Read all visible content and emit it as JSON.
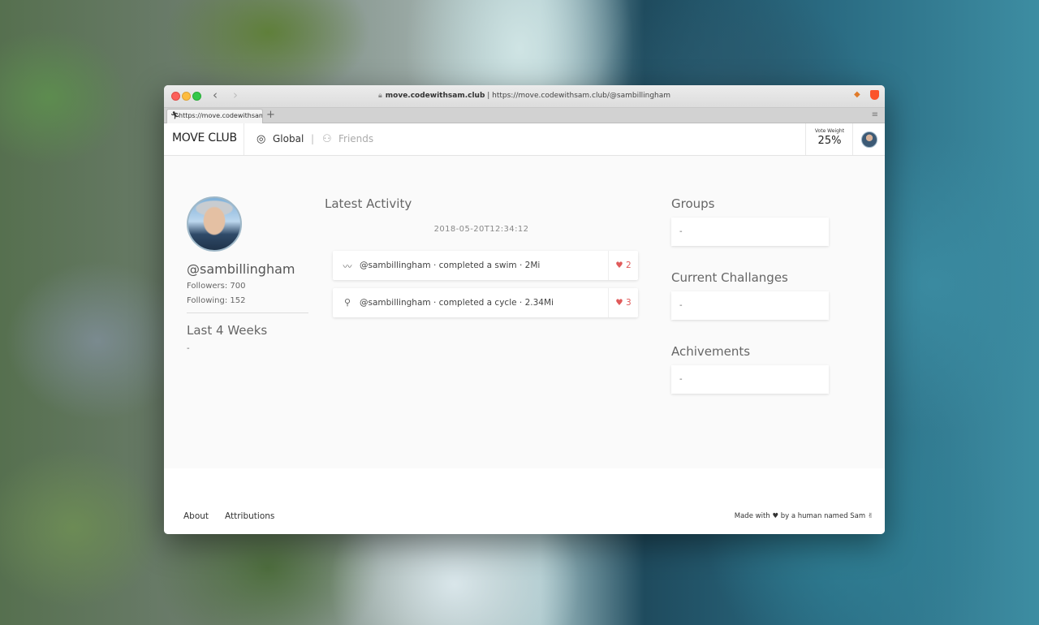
{
  "browser": {
    "address_host": "move.codewithsam.club",
    "address_full": " | https://move.codewithsam.club/@sambillingham",
    "tab_title": "https://move.codewithsam.club/@sambillingham",
    "new_tab": "+",
    "back_icon": "chevron-left-icon",
    "forward_icon": "chevron-right-icon"
  },
  "nav": {
    "brand": "MOVE CLUB",
    "global_label": "Global",
    "separator": "|",
    "friends_label": "Friends",
    "vote_label": "Vote Weight",
    "vote_value": "25%"
  },
  "profile": {
    "username": "@sambillingham",
    "followers": "Followers: 700",
    "following": "Following: 152",
    "weeks_title": "Last 4 Weeks",
    "weeks_value": "-"
  },
  "activity": {
    "title": "Latest Activity",
    "timestamp": "2018-05-20T12:34:12",
    "items": [
      {
        "icon": "swim-icon",
        "text": "@sambillingham · completed a swim · 2Mi",
        "likes": "♥ 2"
      },
      {
        "icon": "bicycle-icon",
        "text": "@sambillingham · completed a cycle · 2.34Mi",
        "likes": "♥ 3"
      }
    ]
  },
  "sidebar": {
    "groups_title": "Groups",
    "groups_value": "-",
    "challenges_title": "Current Challanges",
    "challenges_value": "-",
    "achievements_title": "Achivements",
    "achievements_value": "-"
  },
  "footer": {
    "about": "About",
    "attributions": "Attributions",
    "made_with": "Made with ♥ by a human named Sam ✌"
  },
  "colors": {
    "like": "#e05a5a",
    "background": "#fafafa"
  }
}
